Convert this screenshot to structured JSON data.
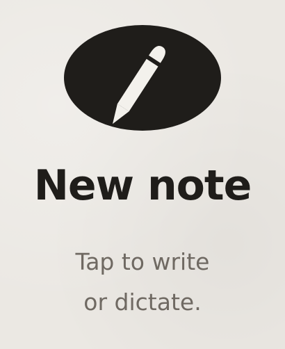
{
  "new_note": {
    "icon": "pencil-icon",
    "title": "New note",
    "subtitle_line1": "Tap to write",
    "subtitle_line2": "or dictate."
  },
  "colors": {
    "background": "#ebe8e3",
    "badge": "#1f1d1a",
    "pencil": "#f3f1ec",
    "title": "#1f1d1a",
    "subtitle": "#6f6962"
  }
}
